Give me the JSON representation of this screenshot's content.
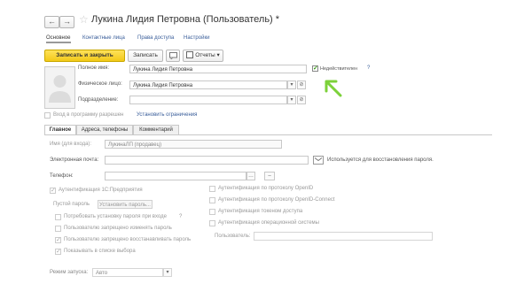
{
  "header": {
    "back_glyph": "←",
    "forward_glyph": "→",
    "title": "Лукина Лидия Петровна (Пользователь) *"
  },
  "nav_tabs": [
    {
      "label": "Основное",
      "active": true
    },
    {
      "label": "Контактные лица",
      "active": false
    },
    {
      "label": "Права доступа",
      "active": false
    },
    {
      "label": "Настройки",
      "active": false
    }
  ],
  "toolbar": {
    "save_close": "Записать и закрыть",
    "save": "Записать",
    "reports": "Отчеты"
  },
  "form": {
    "full_name_label": "Полное имя:",
    "full_name_value": "Лукина Лидия Петровна",
    "inactive_label": "Недействителен",
    "inactive_help": "?",
    "person_label": "Физическое лицо:",
    "person_value": "Лукина Лидия Петровна",
    "dept_label": "Подразделение:",
    "dept_value": "",
    "login_label": "Вход в программу разрешен",
    "set_restrictions": "Установить ограничения"
  },
  "inner_tabs": [
    {
      "label": "Главное",
      "active": true
    },
    {
      "label": "Адреса, телефоны",
      "active": false
    },
    {
      "label": "Комментарий",
      "active": false
    }
  ],
  "main": {
    "login_name_label": "Имя (для входа):",
    "login_name_value": "ЛукинаЛП (продавец)",
    "email_label": "Электронная почта:",
    "email_value": "",
    "email_hint": "Используется для восстановления пароля.",
    "phone_label": "Телефон:",
    "phone_value": "",
    "auth_1c": "Аутентификация 1С:Предприятия",
    "empty_password": "Пустой пароль",
    "set_password": "Установить пароль...",
    "require_password": "Потребовать установку пароля при входе",
    "require_help": "?",
    "forbid_change": "Пользователю запрещено изменять пароль",
    "forbid_restore": "Пользователю запрещено восстанавливать пароль",
    "show_in_list": "Показывать в списке выбора",
    "auth_openid": "Аутентификация по протоколу OpenID",
    "auth_openid_connect": "Аутентификация по протоколу OpenID-Connect",
    "auth_token": "Аутентификация токеном доступа",
    "auth_os": "Аутентификация операционной системы",
    "os_user_label": "Пользователь:",
    "os_user_value": "",
    "launch_mode_label": "Режим запуска:",
    "launch_mode_value": "Авто"
  },
  "colors": {
    "accent_yellow": "#f2c918",
    "link_blue": "#3a5e9a",
    "highlight_arrow": "#7cd13a"
  }
}
